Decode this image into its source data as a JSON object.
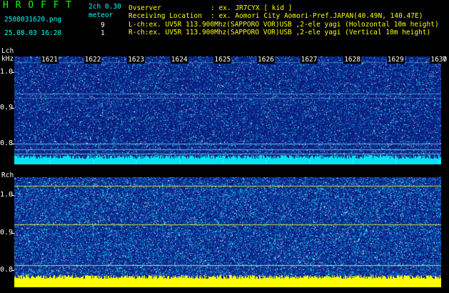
{
  "header": {
    "app_title": "H R O F F T",
    "mode": "2ch 0.30",
    "detector": "meteor",
    "filename": "2508031620.png",
    "datetime": "25.08.03 16:20",
    "lch_count": "9",
    "rch_count": "1"
  },
  "info": {
    "observer_label": "Ovserver",
    "observer_value": ": ex. JR7CYX [ kid ]",
    "location_label": "Receiving Location",
    "location_value": ": ex. Aomori City Aomori-Pref.JAPAN(40.49N, 140.47E)",
    "lch_line": "L-ch:ex. UV5R 113.900Mhz(SAPPORO VOR)USB ,2-ele yagi (Holozontal 10m height)",
    "rch_line": "R-ch:ex. UV5R 113.900Mhz(SAPPORO VOR)USB ,2-ele yagi (Vertical 10m height)"
  },
  "lch": {
    "label": "Lch",
    "unit": "kHz",
    "y_labels": [
      "1.0",
      "0.9",
      "0.8"
    ]
  },
  "rch": {
    "label": "Rch",
    "y_labels": [
      "1.0",
      "0.9",
      "0.8"
    ]
  },
  "freq_axis": {
    "labels": [
      "1621",
      "1622",
      "1623",
      "1624",
      "1625",
      "1626",
      "1627",
      "1628",
      "1629",
      "1630"
    ],
    "edge_label": "7"
  },
  "colors": {
    "title": "#00ff00",
    "header_text": "#00ffff",
    "lch_noise_band": "#00e5f0",
    "rch_noise_band": "#ffff00",
    "spectrogram_bg": "#0a1c7a"
  }
}
